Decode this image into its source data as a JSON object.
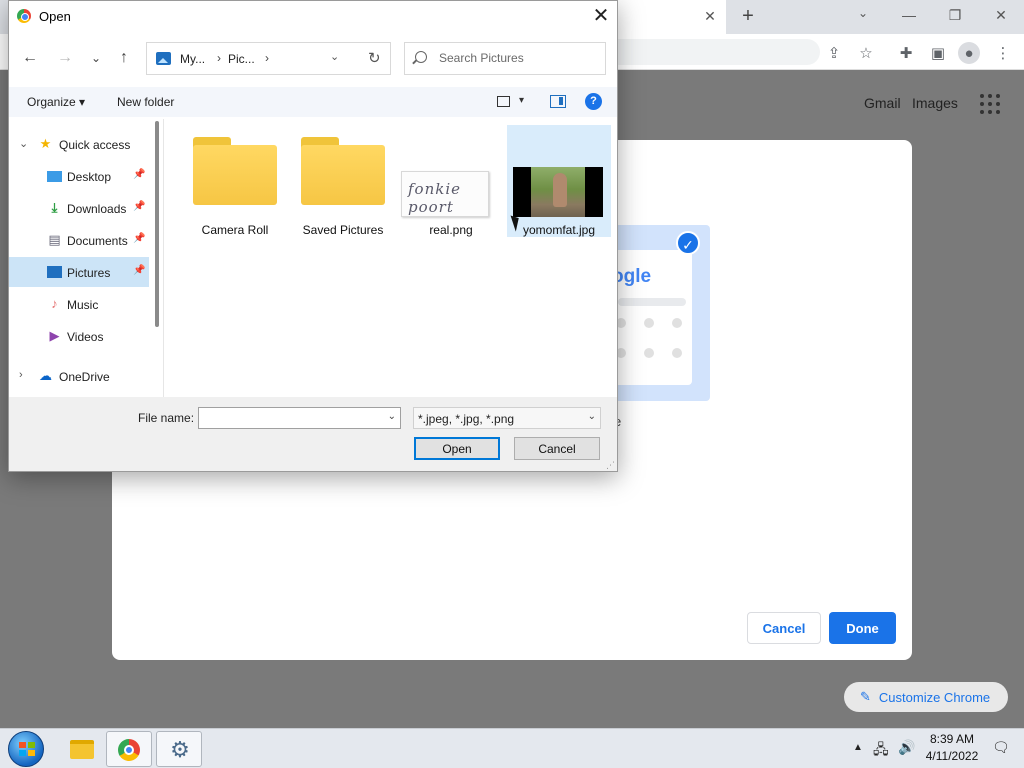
{
  "chrome": {
    "tab_close": "✕",
    "new_tab": "+",
    "tab_search": "⌄",
    "win_minimize": "—",
    "win_restore": "❐",
    "win_close": "✕",
    "links": {
      "gmail": "Gmail",
      "images": "Images"
    }
  },
  "background_dialog": {
    "preview_logo": "ogle",
    "caption_fragment": "e",
    "cancel_label": "Cancel",
    "done_label": "Done",
    "customize_label": "Customize Chrome",
    "accent_color": "#1a73e8"
  },
  "dialog": {
    "title": "Open",
    "close": "✕",
    "back": "←",
    "forward": "→",
    "recent": "⌄",
    "up": "↑",
    "breadcrumbs": [
      "My...",
      "Pic..."
    ],
    "crumb_sep": "›",
    "addr_dropdown": "⌄",
    "addr_refresh": "↻",
    "search_placeholder": "Search Pictures",
    "commands": {
      "organize": "Organize ▾",
      "new_folder": "New folder",
      "view_dropdown": "▾",
      "help": "?"
    },
    "nav": [
      {
        "label": "Quick access",
        "icon": "star-icon"
      },
      {
        "label": "Desktop",
        "icon": "desktop-icon",
        "pinned": true
      },
      {
        "label": "Downloads",
        "icon": "download-icon",
        "pinned": true
      },
      {
        "label": "Documents",
        "icon": "document-icon",
        "pinned": true
      },
      {
        "label": "Pictures",
        "icon": "pictures-icon",
        "pinned": true,
        "selected": true
      },
      {
        "label": "Music",
        "icon": "music-icon"
      },
      {
        "label": "Videos",
        "icon": "video-icon"
      },
      {
        "label": "OneDrive",
        "icon": "cloud-icon"
      }
    ],
    "chevrons": {
      "expanded": "⌄",
      "collapsed": "›"
    },
    "pin_glyph": "📌",
    "files": [
      {
        "label": "Camera Roll",
        "kind": "folder"
      },
      {
        "label": "Saved Pictures",
        "kind": "folder"
      },
      {
        "label": "real.png",
        "kind": "image-signature",
        "thumb_text": "fonkie poort"
      },
      {
        "label": "yomomfat.jpg",
        "kind": "image-photo",
        "selected": true
      }
    ],
    "file_name_label": "File name:",
    "file_name_value": "",
    "combo_arrow": "⌄",
    "file_type": "*.jpeg, *.jpg, *.png",
    "open_label": "Open",
    "cancel_label": "Cancel",
    "grip": "⋰"
  },
  "taskbar": {
    "tray_arrow": "▲",
    "tray_network": "🖧",
    "tray_volume": "🔊",
    "tray_notification": "🗨",
    "time": "8:39 AM",
    "date": "4/11/2022"
  }
}
